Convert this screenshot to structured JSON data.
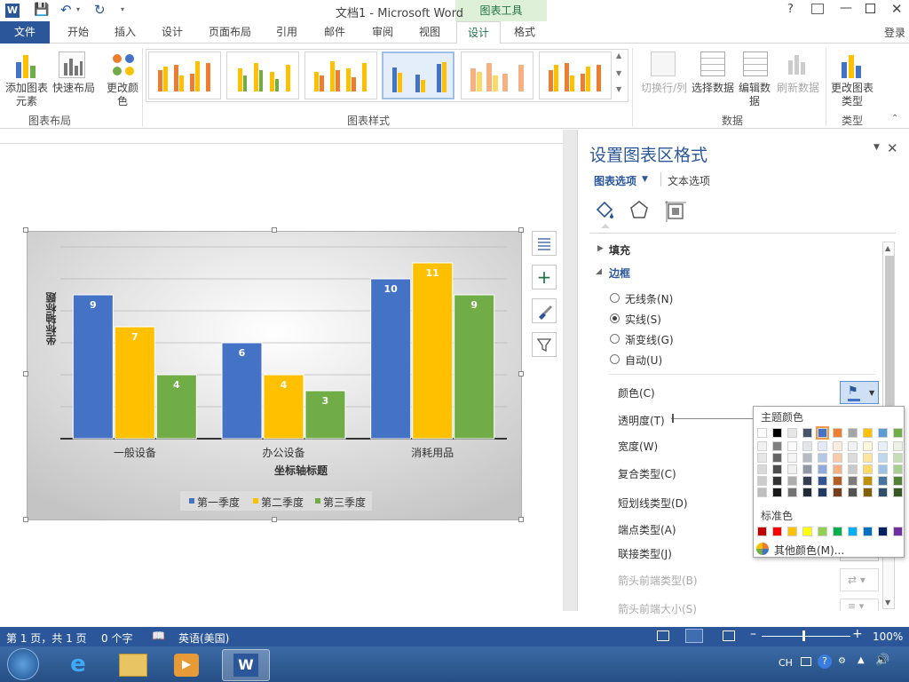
{
  "window": {
    "title": "文档1 - Microsoft Word",
    "context_tab_group": "图表工具",
    "login": "登录",
    "help": "?"
  },
  "tabs": [
    {
      "label": "文件"
    },
    {
      "label": "开始"
    },
    {
      "label": "插入"
    },
    {
      "label": "设计"
    },
    {
      "label": "页面布局"
    },
    {
      "label": "引用"
    },
    {
      "label": "邮件"
    },
    {
      "label": "审阅"
    },
    {
      "label": "视图"
    },
    {
      "label": "设计"
    },
    {
      "label": "格式"
    }
  ],
  "ribbon": {
    "add_element": "添加图表元素",
    "quick_layout": "快速布局",
    "change_color": "更改颜色",
    "group_layout": "图表布局",
    "group_styles": "图表样式",
    "switch_row_col": "切换行/列",
    "select_data": "选择数据",
    "edit_data": "编辑数据",
    "refresh_data": "刷新数据",
    "group_data": "数据",
    "change_type": "更改图表类型",
    "group_type": "类型"
  },
  "chart_data": {
    "type": "bar",
    "categories": [
      "一般设备",
      "办公设备",
      "消耗用品"
    ],
    "series": [
      {
        "name": "第一季度",
        "values": [
          9,
          6,
          10
        ],
        "color": "#4472c4"
      },
      {
        "name": "第二季度",
        "values": [
          7,
          4,
          11
        ],
        "color": "#ffc000"
      },
      {
        "name": "第三季度",
        "values": [
          4,
          3,
          9
        ],
        "color": "#70ad47"
      }
    ],
    "xlabel": "坐标轴标题",
    "ylabel": "坐标轴标题",
    "ylim": [
      0,
      12
    ],
    "grid": true,
    "legend": "bottom"
  },
  "pane": {
    "title": "设置图表区格式",
    "tab_chart_options": "图表选项",
    "tab_text_options": "文本选项",
    "section_fill": "填充",
    "section_border": "边框",
    "radio_none": "无线条(N)",
    "radio_solid": "实线(S)",
    "radio_gradient": "渐变线(G)",
    "radio_auto": "自动(U)",
    "color": "颜色(C)",
    "transparency": "透明度(T)",
    "width": "宽度(W)",
    "compound": "复合类型(C)",
    "dash": "短划线类型(D)",
    "cap": "端点类型(A)",
    "join": "联接类型(J)",
    "arrow_begin_type": "箭头前端类型(B)",
    "arrow_begin_size": "箭头前端大小(S)"
  },
  "color_popup": {
    "theme_label": "主题颜色",
    "standard_label": "标准色",
    "more_colors": "其他颜色(M)...",
    "theme_top": [
      "#ffffff",
      "#000000",
      "#e7e6e6",
      "#44546a",
      "#4472c4",
      "#ed7d31",
      "#a5a5a5",
      "#ffc000",
      "#5b9bd5",
      "#70ad47"
    ],
    "standard": [
      "#c00000",
      "#ff0000",
      "#ffc000",
      "#ffff00",
      "#92d050",
      "#00b050",
      "#00b0f0",
      "#0070c0",
      "#002060",
      "#7030a0"
    ]
  },
  "status": {
    "page": "第 1 页，共 1 页",
    "words": "0 个字",
    "language": "英语(美国)",
    "zoom": "100%"
  },
  "taskbar": {
    "ime": "CH"
  }
}
